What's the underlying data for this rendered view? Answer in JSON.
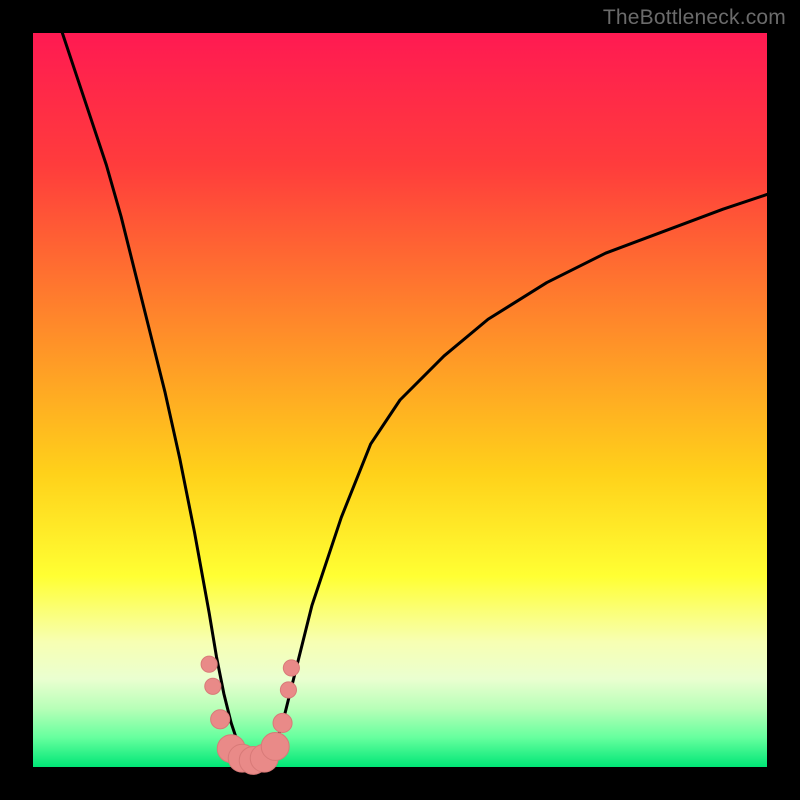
{
  "watermark": "TheBottleneck.com",
  "colors": {
    "frame": "#000000",
    "gradient_stops": [
      {
        "pct": 0,
        "color": "#ff1a52"
      },
      {
        "pct": 18,
        "color": "#ff3c3c"
      },
      {
        "pct": 40,
        "color": "#ff8a2a"
      },
      {
        "pct": 60,
        "color": "#ffd11a"
      },
      {
        "pct": 74,
        "color": "#ffff33"
      },
      {
        "pct": 83,
        "color": "#f7ffb3"
      },
      {
        "pct": 88,
        "color": "#eaffd0"
      },
      {
        "pct": 92,
        "color": "#b8ffb8"
      },
      {
        "pct": 96,
        "color": "#66ff9e"
      },
      {
        "pct": 100,
        "color": "#00e676"
      }
    ],
    "curve": "#000000",
    "marker_fill": "#e98a88",
    "marker_stroke": "#d87a78"
  },
  "chart_data": {
    "type": "line",
    "title": "",
    "xlabel": "",
    "ylabel": "",
    "xlim": [
      0,
      100
    ],
    "ylim": [
      0,
      100
    ],
    "grid": false,
    "legend": false,
    "note": "V-shaped bottleneck curve. x ≈ relative component balance (%), y ≈ bottleneck (%). Values estimated from pixel positions; no axis ticks are rendered.",
    "series": [
      {
        "name": "bottleneck-curve",
        "x": [
          4,
          6,
          8,
          10,
          12,
          14,
          16,
          18,
          20,
          22,
          24,
          25,
          26,
          27,
          28,
          29,
          30,
          31,
          32,
          33,
          34,
          36,
          38,
          42,
          46,
          50,
          56,
          62,
          70,
          78,
          86,
          94,
          100
        ],
        "y": [
          100,
          94,
          88,
          82,
          75,
          67,
          59,
          51,
          42,
          32,
          21,
          15,
          10,
          6,
          3,
          1.5,
          1,
          1,
          1.5,
          3,
          6,
          14,
          22,
          34,
          44,
          50,
          56,
          61,
          66,
          70,
          73,
          76,
          78
        ]
      }
    ],
    "markers": {
      "name": "highlight-dots",
      "points": [
        {
          "x": 24.0,
          "y": 14.0,
          "r": 1.1
        },
        {
          "x": 24.5,
          "y": 11.0,
          "r": 1.1
        },
        {
          "x": 25.5,
          "y": 6.5,
          "r": 1.3
        },
        {
          "x": 27.0,
          "y": 2.5,
          "r": 1.9
        },
        {
          "x": 28.5,
          "y": 1.2,
          "r": 1.9
        },
        {
          "x": 30.0,
          "y": 0.9,
          "r": 1.9
        },
        {
          "x": 31.5,
          "y": 1.2,
          "r": 1.9
        },
        {
          "x": 33.0,
          "y": 2.8,
          "r": 1.9
        },
        {
          "x": 34.0,
          "y": 6.0,
          "r": 1.3
        },
        {
          "x": 34.8,
          "y": 10.5,
          "r": 1.1
        },
        {
          "x": 35.2,
          "y": 13.5,
          "r": 1.1
        }
      ]
    }
  }
}
